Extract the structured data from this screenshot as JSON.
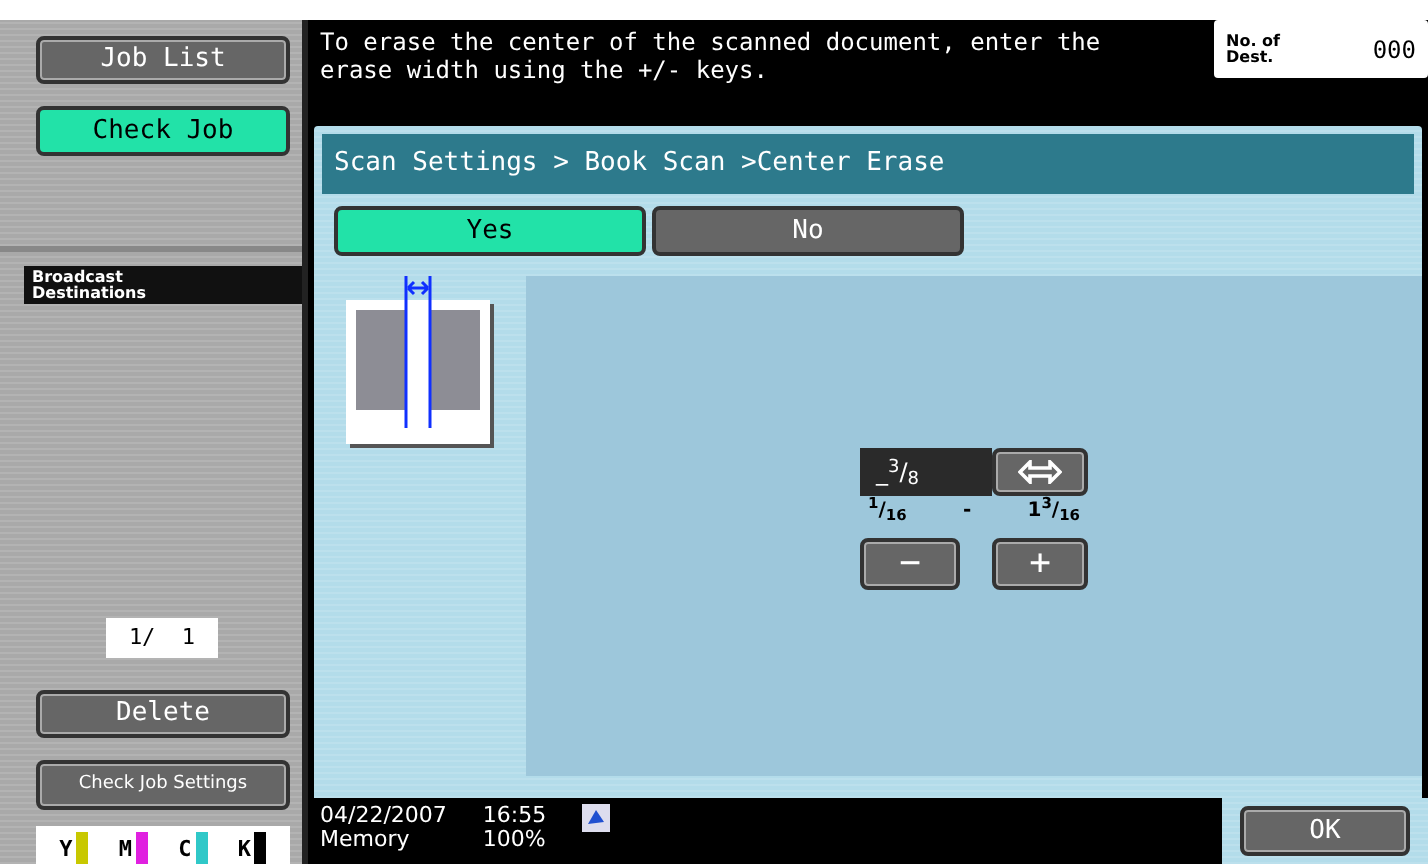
{
  "sidebar": {
    "job_list": "Job List",
    "check_job": "Check Job",
    "broadcast": "Broadcast Destinations",
    "page_counter": "1/  1",
    "delete": "Delete",
    "check_job_settings": "Check Job Settings",
    "toners": [
      {
        "label": "Y",
        "color": "#c8c800"
      },
      {
        "label": "M",
        "color": "#e020e0"
      },
      {
        "label": "C",
        "color": "#30c8c8"
      },
      {
        "label": "K",
        "color": "#000000"
      }
    ]
  },
  "message": "To erase the center of the scanned document, enter the erase width using the +/- keys.",
  "dest_count": {
    "label": "No. of Dest.",
    "value": "000"
  },
  "breadcrumb": "Scan Settings > Book Scan >Center Erase",
  "options": [
    {
      "label": "Yes",
      "selected": true
    },
    {
      "label": "No",
      "selected": false
    }
  ],
  "erase_width": {
    "value": "_$^{3}$/$_{8}$",
    "min": "$^{1}$/$_{16}$",
    "dash": "-",
    "max": "1$^{3}$/$_{16}$",
    "minus": "−",
    "plus": "+"
  },
  "status": {
    "date": "04/22/2007",
    "time": "16:55",
    "memory_label": "Memory",
    "memory_value": "100%"
  },
  "ok": "OK"
}
